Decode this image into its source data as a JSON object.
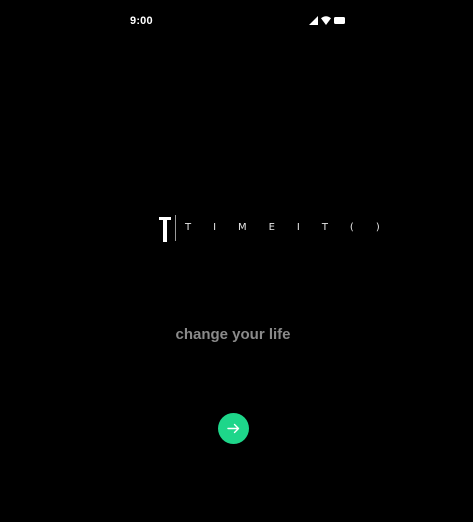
{
  "status_bar": {
    "time": "9:00",
    "icons": [
      "cellular-signal-icon",
      "wifi-icon",
      "battery-icon"
    ]
  },
  "logo": {
    "mark": "T",
    "text": "T I M E I T ( )"
  },
  "tagline": "change your life",
  "next_button": {
    "icon": "arrow-right-icon"
  },
  "colors": {
    "background": "#000000",
    "accent": "#1ED68A",
    "tagline": "#8A8A8A",
    "logo_text": "#E6E6E6"
  }
}
